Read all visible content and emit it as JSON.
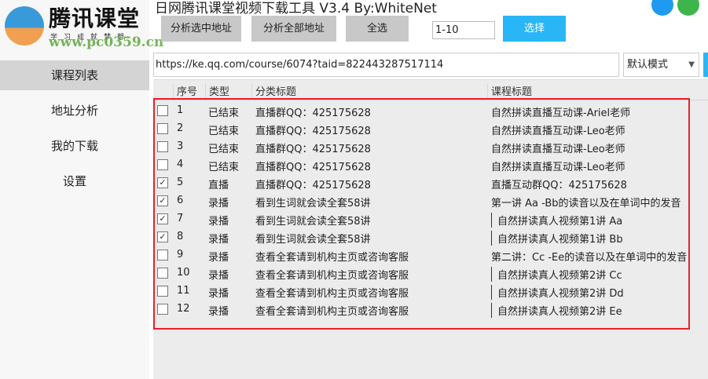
{
  "app": {
    "title": "日网腾讯课堂视频下载工具 V3.4 By:WhiteNet",
    "logo_title": "腾讯课堂",
    "logo_sub": "学习成就梦想",
    "watermark": "www.pc0359.cn"
  },
  "sidebar": {
    "items": [
      {
        "label": "课程列表",
        "active": true
      },
      {
        "label": "地址分析"
      },
      {
        "label": "我的下载"
      },
      {
        "label": "设置"
      }
    ]
  },
  "toolbar": {
    "analyze_selected": "分析选中地址",
    "analyze_all": "分析全部地址",
    "select_all": "全选",
    "range_value": "1-10",
    "choose": "选择"
  },
  "url_bar": {
    "value": "https://ke.qq.com/course/6074?taid=822443287517114",
    "mode": "默认模式"
  },
  "table": {
    "headers": [
      "序号",
      "类型",
      "分类标题",
      "课程标题"
    ],
    "rows": [
      {
        "no": "1",
        "type": "已结束",
        "category": "直播群QQ：425175628",
        "title": "自然拼读直播互动课-Ariel老师",
        "checked": false,
        "bar": false
      },
      {
        "no": "2",
        "type": "已结束",
        "category": "直播群QQ：425175628",
        "title": "自然拼读直播互动课-Leo老师",
        "checked": false,
        "bar": false
      },
      {
        "no": "3",
        "type": "已结束",
        "category": "直播群QQ：425175628",
        "title": "自然拼读直播互动课-Leo老师",
        "checked": false,
        "bar": false
      },
      {
        "no": "4",
        "type": "已结束",
        "category": "直播群QQ：425175628",
        "title": "自然拼读直播互动课-Leo老师",
        "checked": false,
        "bar": false
      },
      {
        "no": "5",
        "type": "直播",
        "category": "直播群QQ：425175628",
        "title": "直播互动群QQ：425175628",
        "checked": true,
        "bar": false
      },
      {
        "no": "6",
        "type": "录播",
        "category": "看到生词就会读全套58讲",
        "title": "第一讲 Aa -Bb的读音以及在单词中的发音",
        "checked": true,
        "bar": false
      },
      {
        "no": "7",
        "type": "录播",
        "category": "看到生词就会读全套58讲",
        "title": "自然拼读真人视频第1讲 Aa",
        "checked": true,
        "bar": true
      },
      {
        "no": "8",
        "type": "录播",
        "category": "看到生词就会读全套58讲",
        "title": "自然拼读真人视频第1讲 Bb",
        "checked": true,
        "bar": true
      },
      {
        "no": "9",
        "type": "录播",
        "category": "查看全套请到机构主页或咨询客服",
        "title": "第二讲：Cc -Ee的读音以及在单词中的发音",
        "checked": false,
        "bar": false
      },
      {
        "no": "10",
        "type": "录播",
        "category": "查看全套请到机构主页或咨询客服",
        "title": "自然拼读真人视频第2讲 Cc",
        "checked": false,
        "bar": true
      },
      {
        "no": "11",
        "type": "录播",
        "category": "查看全套请到机构主页或咨询客服",
        "title": "自然拼读真人视频第2讲 Dd",
        "checked": false,
        "bar": true
      },
      {
        "no": "12",
        "type": "录播",
        "category": "查看全套请到机构主页或咨询客服",
        "title": "自然拼读真人视频第2讲 Ee",
        "checked": false,
        "bar": true
      }
    ]
  },
  "colors": {
    "accent": "#29b6f6",
    "highlight": "#e8202a",
    "qq": "#1e9bf0",
    "wechat": "#3cb64a"
  }
}
